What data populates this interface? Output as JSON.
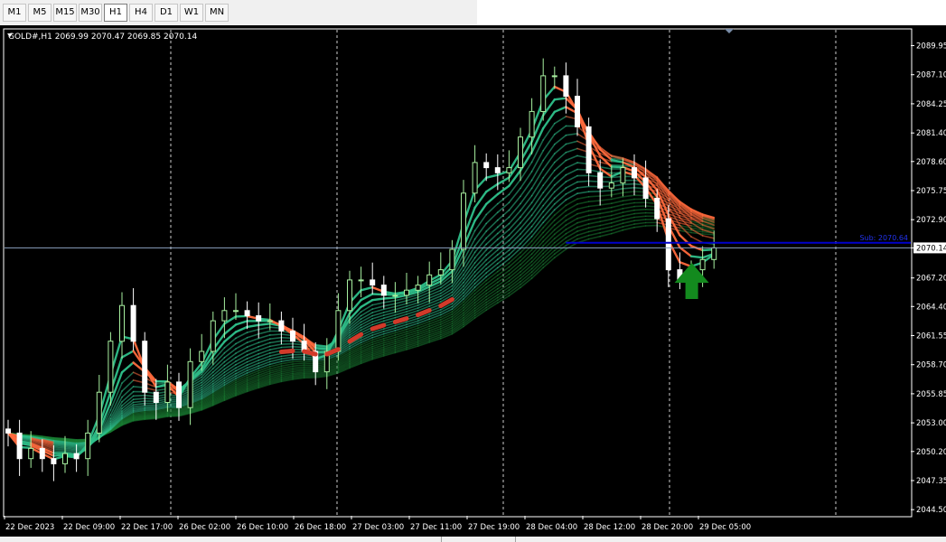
{
  "timeframes": [
    {
      "label": "M1",
      "active": false
    },
    {
      "label": "M5",
      "active": false
    },
    {
      "label": "M15",
      "active": false
    },
    {
      "label": "M30",
      "active": false
    },
    {
      "label": "H1",
      "active": true
    },
    {
      "label": "H4",
      "active": false
    },
    {
      "label": "D1",
      "active": false
    },
    {
      "label": "W1",
      "active": false
    },
    {
      "label": "MN",
      "active": false
    }
  ],
  "chart_data": {
    "type": "candlestick",
    "header": "GOLD#,H1  2069.99 2070.47 2069.85 2070.14",
    "symbol": "GOLD#",
    "timeframe": "H1",
    "ohlc": {
      "open": 2069.99,
      "high": 2070.47,
      "low": 2069.85,
      "close": 2070.14
    },
    "ylim": [
      2043.9,
      2091.5
    ],
    "y_ticks": [
      2089.95,
      2087.1,
      2084.25,
      2081.4,
      2078.6,
      2075.75,
      2072.9,
      2070.14,
      2067.2,
      2064.4,
      2061.55,
      2058.7,
      2055.85,
      2053.0,
      2050.2,
      2047.35,
      2044.5
    ],
    "y_tick_labels": [
      "2089.95",
      "2087.10",
      "2084.25",
      "2081.40",
      "2078.60",
      "2075.75",
      "2072.90",
      "2070.14",
      "2067.20",
      "2064.40",
      "2061.55",
      "2058.70",
      "2055.85",
      "2053.00",
      "2050.20",
      "2047.35",
      "2044.50"
    ],
    "x_labels": [
      "22 Dec 2023",
      "22 Dec 09:00",
      "22 Dec 17:00",
      "26 Dec 02:00",
      "26 Dec 10:00",
      "26 Dec 18:00",
      "27 Dec 03:00",
      "27 Dec 11:00",
      "27 Dec 19:00",
      "28 Dec 04:00",
      "28 Dec 12:00",
      "28 Dec 20:00",
      "29 Dec 05:00"
    ],
    "current_price": 2070.14,
    "horizontal_line": {
      "label": "Sub: 2070.64",
      "value": 2070.64,
      "color": "#0000cc"
    },
    "signal": {
      "type": "buy-arrow",
      "color": "#138a1e"
    },
    "grid": "vertical-dashed",
    "colors": {
      "background": "#000000",
      "bull": "#a8f0a0",
      "bear": "#ffffff",
      "ribbon_up": "#2ec08a",
      "ribbon_down": "#ff6a3d",
      "ribbon_deep": "#1a7d33",
      "axis": "#ffffff"
    },
    "close_path": [
      [
        0,
        2052
      ],
      [
        1,
        2049.5
      ],
      [
        2,
        2050.5
      ],
      [
        3,
        2049.5
      ],
      [
        4,
        2049
      ],
      [
        5,
        2050
      ],
      [
        6,
        2049.5
      ],
      [
        7,
        2052
      ],
      [
        8,
        2056
      ],
      [
        9,
        2061
      ],
      [
        10,
        2064.5
      ],
      [
        11,
        2061
      ],
      [
        12,
        2056
      ],
      [
        13,
        2055
      ],
      [
        14,
        2057
      ],
      [
        15,
        2054.5
      ],
      [
        16,
        2059
      ],
      [
        17,
        2060
      ],
      [
        18,
        2063
      ],
      [
        19,
        2064
      ],
      [
        20,
        2064
      ],
      [
        21,
        2063.5
      ],
      [
        22,
        2063
      ],
      [
        23,
        2063
      ],
      [
        24,
        2062
      ],
      [
        25,
        2061
      ],
      [
        26,
        2060
      ],
      [
        27,
        2058
      ],
      [
        28,
        2060
      ],
      [
        29,
        2064
      ],
      [
        30,
        2067
      ],
      [
        31,
        2067
      ],
      [
        32,
        2066.5
      ],
      [
        33,
        2065.5
      ],
      [
        34,
        2065.5
      ],
      [
        35,
        2066
      ],
      [
        36,
        2066.5
      ],
      [
        37,
        2067.5
      ],
      [
        38,
        2068
      ],
      [
        39,
        2070
      ],
      [
        40,
        2075.5
      ],
      [
        41,
        2078.5
      ],
      [
        42,
        2078
      ],
      [
        43,
        2077.5
      ],
      [
        44,
        2078
      ],
      [
        45,
        2081
      ],
      [
        46,
        2083.5
      ],
      [
        47,
        2087
      ],
      [
        48,
        2087
      ],
      [
        49,
        2085
      ],
      [
        50,
        2082
      ],
      [
        51,
        2077.5
      ],
      [
        52,
        2076
      ],
      [
        53,
        2076.5
      ],
      [
        54,
        2078
      ],
      [
        55,
        2077
      ],
      [
        56,
        2075
      ],
      [
        57,
        2073
      ],
      [
        58,
        2068
      ],
      [
        59,
        2067
      ],
      [
        60,
        2068
      ],
      [
        61,
        2069
      ],
      [
        62,
        2070.14
      ]
    ]
  }
}
